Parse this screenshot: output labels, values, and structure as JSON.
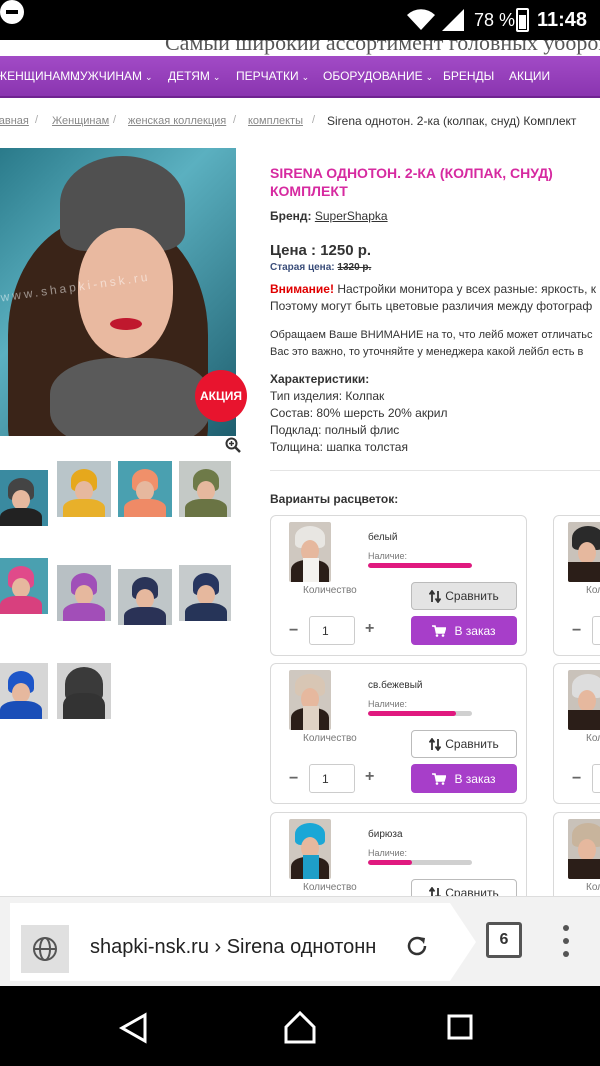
{
  "status_bar": {
    "battery": "78 %",
    "time": "11:48"
  },
  "banner": {
    "text": "Самый широкий ассортимент головных уборов в Новосибирске"
  },
  "nav": {
    "items": [
      {
        "label": "ЖЕНЩИНАМ",
        "chev": "⌄"
      },
      {
        "label": "МУЖЧИНАМ",
        "chev": "⌄"
      },
      {
        "label": "ДЕТЯМ",
        "chev": "⌄"
      },
      {
        "label": "ПЕРЧАТКИ",
        "chev": "⌄"
      },
      {
        "label": "ОБОРУДОВАНИЕ",
        "chev": "⌄"
      },
      {
        "label": "БРЕНДЫ",
        "chev": ""
      },
      {
        "label": "АКЦИИ",
        "chev": ""
      }
    ]
  },
  "breadcrumb": {
    "items": [
      "Главная",
      "Женщинам",
      "женская коллекция",
      "комплекты"
    ],
    "sep": "/",
    "current": "Sirena однотон. 2-ка (колпак, снуд) Комплект"
  },
  "gallery": {
    "watermark": "www.shapki-nsk.ru",
    "badge": "АКЦИЯ"
  },
  "product": {
    "title": "SIRENA ОДНОТОН. 2-КА (КОЛПАК, СНУД) КОМПЛЕКТ",
    "brand_label": "Бренд:",
    "brand": "SuperShapka",
    "price": "Цена : 1250 р.",
    "old_price_label": "Старая цена:",
    "old_price": "1320 р.",
    "warning_label": "Внимание!",
    "warning_text": " Настройки монитора у всех разные: яркость, к",
    "warning_text2": "Поэтому могут быть цветовые различия между фотограф",
    "notice1": "Обращаем Ваше ВНИМАНИЕ на то, что лейб может отличатьс",
    "notice2": "Вас это важно, то уточняйте у менеджера какой лейбл есть в",
    "chars_title": "Характеристики:",
    "chars": [
      "Тип изделия: Колпак",
      "Состав: 80% шерсть 20% акрил",
      "Подклад: полный флис",
      "Толщина: шапка толстая"
    ]
  },
  "variants": {
    "title": "Варианты расцветок:",
    "availability_label": "Наличие:",
    "qty_label": "Количество",
    "compare_label": "Сравнить",
    "order_label": "В заказ",
    "minus": "−",
    "plus": "+",
    "items": [
      {
        "name": "белый",
        "qty": "1",
        "stock": 1.0,
        "compare_active": true,
        "hat_color": "#e8e6e2",
        "scarf_color": "#f4f2ee"
      },
      {
        "name": "св.бежевый",
        "qty": "1",
        "stock": 0.85,
        "compare_active": false,
        "hat_color": "#d8c6b4",
        "scarf_color": "#e0d2c4"
      },
      {
        "name": "бирюза",
        "qty": "1",
        "stock": 0.42,
        "compare_active": false,
        "hat_color": "#1aa7d6",
        "scarf_color": "#1e9ec8"
      }
    ],
    "partial_qty_label": "Кол"
  },
  "address_bar": {
    "url": "shapki-nsk.ru › Sirena однотонн",
    "tabs": "6"
  },
  "colors": {
    "accent_purple": "#a73ec9",
    "title_pink": "#d62aa0",
    "sale_red": "#e8142e",
    "stock_pink": "#e0197f"
  },
  "icons": [
    "do-not-disturb-icon",
    "wifi-icon",
    "signal-icon",
    "battery-icon",
    "zoom-icon",
    "compare-icon",
    "cart-icon",
    "globe-icon",
    "reload-icon",
    "menu-icon",
    "back-icon",
    "home-icon",
    "recents-icon"
  ]
}
